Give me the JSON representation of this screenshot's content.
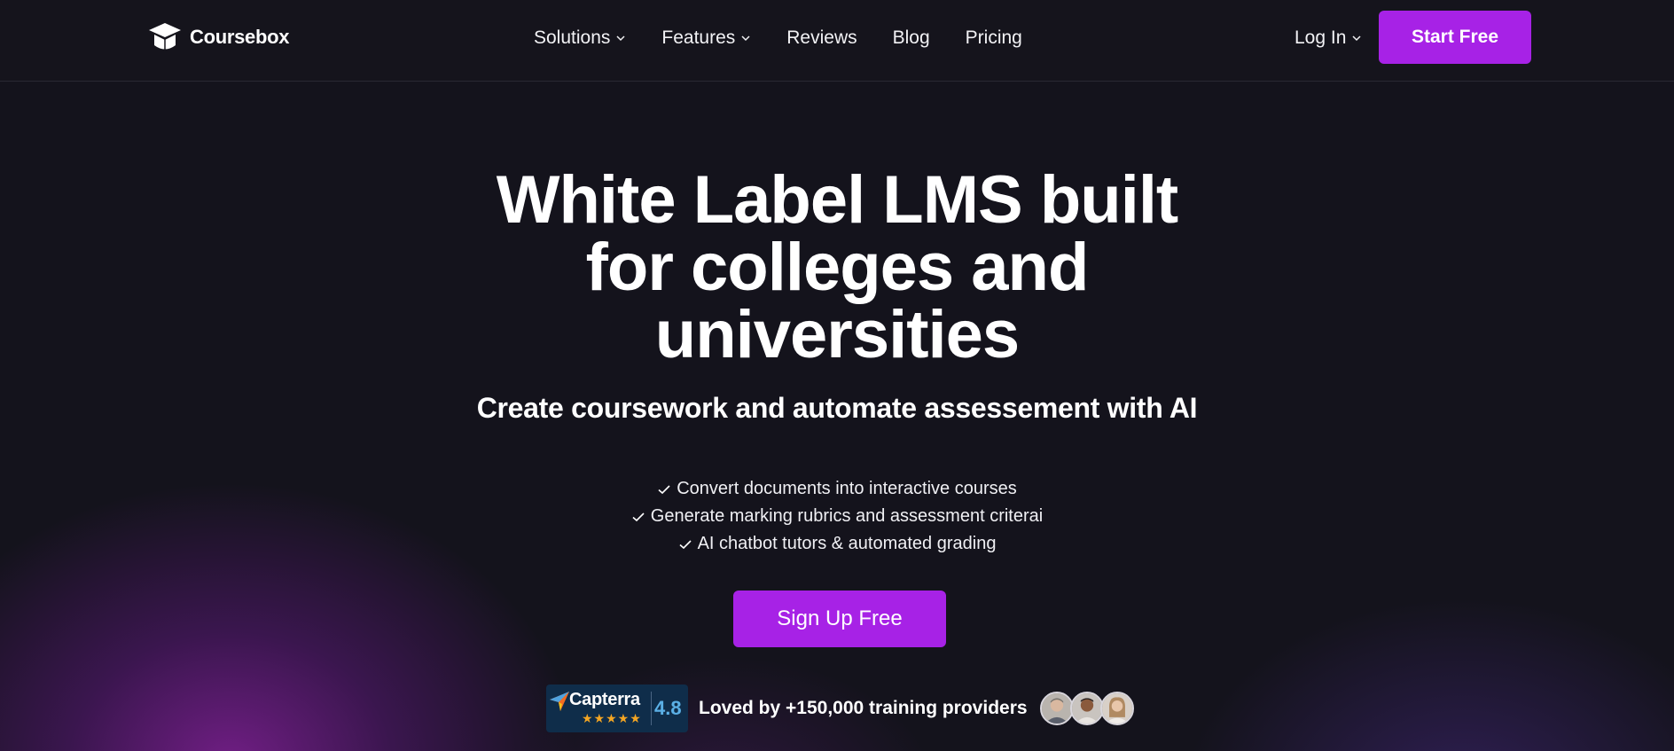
{
  "header": {
    "logo_text": "Coursebox",
    "nav": [
      {
        "label": "Solutions",
        "has_dropdown": true
      },
      {
        "label": "Features",
        "has_dropdown": true
      },
      {
        "label": "Reviews",
        "has_dropdown": false
      },
      {
        "label": "Blog",
        "has_dropdown": false
      },
      {
        "label": "Pricing",
        "has_dropdown": false
      }
    ],
    "login_label": "Log In",
    "start_label": "Start Free"
  },
  "hero": {
    "title_line1": "White Label LMS built",
    "title_line2": "for colleges and",
    "title_line3": "universities",
    "subtitle": "Create coursework and automate assessement with AI",
    "features": [
      "Convert documents into interactive courses",
      "Generate marking rubrics and assessment criterai",
      "AI chatbot tutors & automated grading"
    ],
    "cta_label": "Sign Up Free"
  },
  "social_proof": {
    "capterra_name": "Capterra",
    "capterra_stars": "★★★★★",
    "capterra_score": "4.8",
    "text": "Loved by +150,000 training providers"
  },
  "colors": {
    "accent": "#a722e6",
    "background": "#14131c",
    "capterra_bg": "#0f2d4a",
    "star": "#f5a623"
  },
  "icons": [
    "logo-icon",
    "chevron-down-icon",
    "check-icon",
    "capterra-logo-icon"
  ]
}
